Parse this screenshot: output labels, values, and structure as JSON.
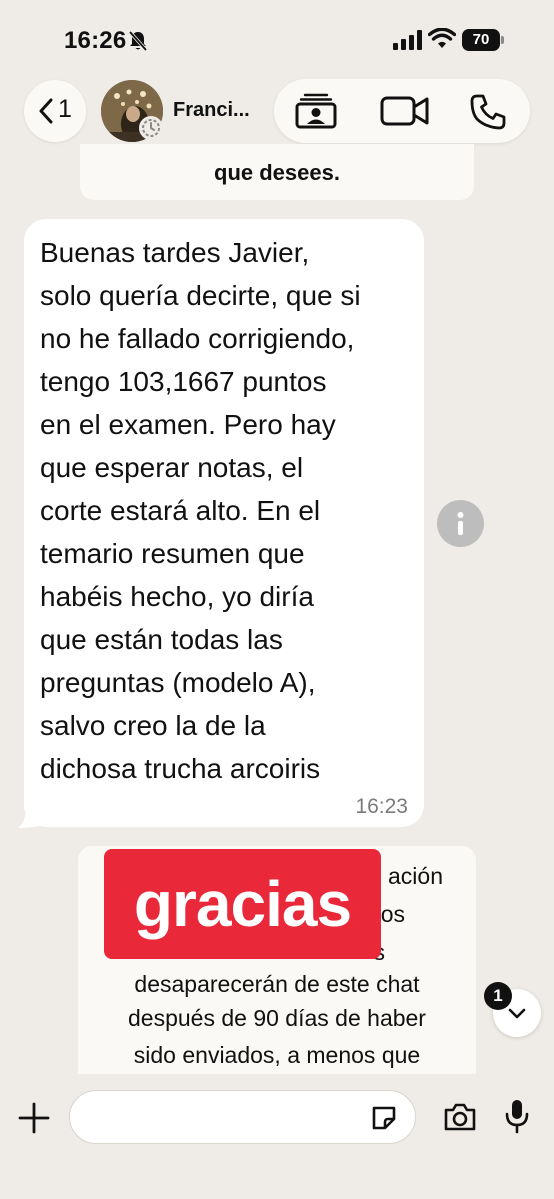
{
  "status_bar": {
    "time": "16:26",
    "battery": "70"
  },
  "header": {
    "back_count": "1",
    "contact_name": "Franci..."
  },
  "system_top": {
    "text": "que desees."
  },
  "message": {
    "text": "Buenas tardes Javier,\nsolo quería decirte, que si\nno he fallado corrigiendo,\ntengo 103,1667 puntos\nen el examen. Pero hay\nque esperar notas, el\ncorte estará alto. En el\ntemario resumen que\nhabéis hecho, yo diría\nque están todas las\npreguntas (modelo A),\nsalvo creo la de la\ndichosa trucha arcoiris",
    "time": "16:23"
  },
  "system_bottom": {
    "line1": "ación",
    "line2": "os",
    "line3": "s",
    "line4": "desaparecerán de este chat",
    "line5": "después de 90 días de haber",
    "line6": "sido enviados, a menos que"
  },
  "sticker": {
    "text": "gracias",
    "color": "#e9283a"
  },
  "unread_badge": "1",
  "composer": {
    "placeholder": ""
  },
  "icons": {
    "back": "chevron-left-icon",
    "mute": "bell-slash-icon",
    "contact_card": "contact-card-icon",
    "video": "video-camera-icon",
    "call": "phone-icon",
    "info": "info-icon",
    "scroll": "chevron-down-icon",
    "add": "plus-icon",
    "sticker": "sticker-icon",
    "camera": "camera-icon",
    "mic": "microphone-icon"
  }
}
